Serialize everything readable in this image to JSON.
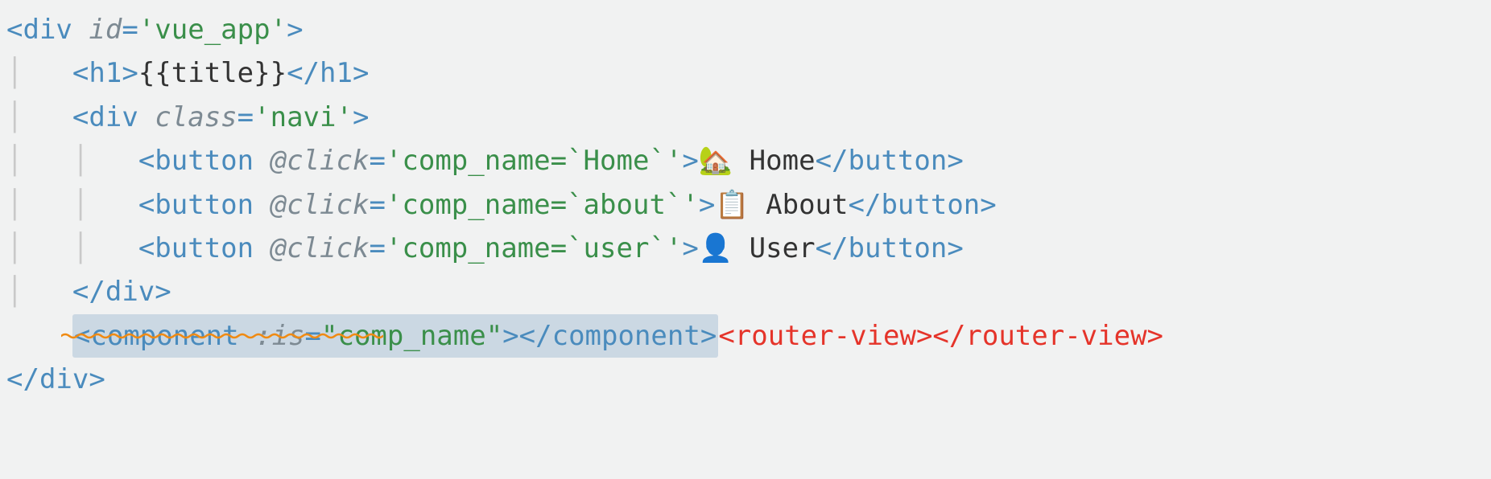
{
  "lines": {
    "l1": {
      "open": "<",
      "tag": "div",
      "sp": " ",
      "attr": "id",
      "eq": "=",
      "val": "'vue_app'",
      "close": ">"
    },
    "l2": {
      "indent": "    ",
      "open1": "<",
      "tag1": "h1",
      "close1": ">",
      "mustache": "{{title}}",
      "open2": "</",
      "tag2": "h1",
      "close2": ">"
    },
    "l3": {
      "indent": "    ",
      "open": "<",
      "tag": "div",
      "sp": " ",
      "attr": "class",
      "eq": "=",
      "val": "'navi'",
      "close": ">"
    },
    "l4": {
      "indent": "        ",
      "open": "<",
      "tag": "button",
      "sp": " ",
      "attr": "@click",
      "eq": "=",
      "val": "'comp_name=`Home`'",
      "close": ">",
      "text": "🏡 Home",
      "open2": "</",
      "tag2": "button",
      "close2": ">"
    },
    "l5": {
      "indent": "        ",
      "open": "<",
      "tag": "button",
      "sp": " ",
      "attr": "@click",
      "eq": "=",
      "val": "'comp_name=`about`'",
      "close": ">",
      "text": "📋 About",
      "open2": "</",
      "tag2": "button",
      "close2": ">"
    },
    "l6": {
      "indent": "        ",
      "open": "<",
      "tag": "button",
      "sp": " ",
      "attr": "@click",
      "eq": "=",
      "val": "'comp_name=`user`'",
      "close": ">",
      "text": "👤 User",
      "open2": "</",
      "tag2": "button",
      "close2": ">"
    },
    "l7": {
      "indent": "    ",
      "open": "</",
      "tag": "div",
      "close": ">"
    },
    "l8": {
      "indent": "    ",
      "hl_open": "<",
      "hl_tag": "component",
      "hl_sp": " ",
      "hl_attr": ":is",
      "hl_eq": "=",
      "hl_val": "\"comp_name\"",
      "hl_close": ">",
      "hl_open2": "</",
      "hl_tag2": "component",
      "hl_close2": ">",
      "router": "<router-view></router-view>"
    },
    "l9": {
      "open": "</",
      "tag": "div",
      "close": ">"
    }
  }
}
